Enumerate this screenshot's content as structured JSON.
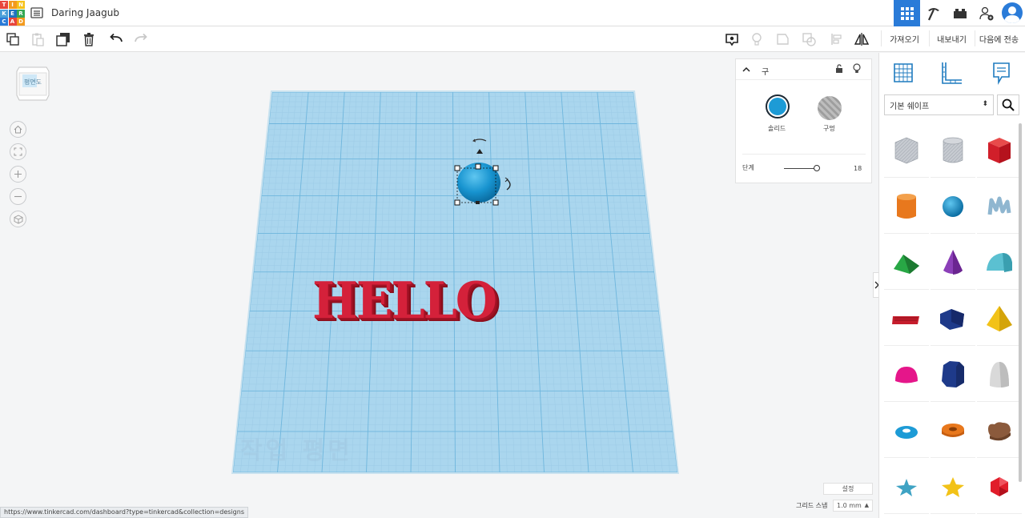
{
  "app": {
    "logo_letters": [
      "T",
      "I",
      "N",
      "K",
      "E",
      "R",
      "C",
      "A",
      "D"
    ],
    "logo_colors": [
      "#e8453c",
      "#f39a1e",
      "#f6c21a",
      "#4a9fd8",
      "#1f72bf",
      "#36a853",
      "#2a7bd8",
      "#e8453c",
      "#f39a1e"
    ],
    "design_title": "Daring Jaagub"
  },
  "topbar": {
    "buttons": [
      {
        "name": "3d-design-view",
        "icon": "grid-icon"
      },
      {
        "name": "codeblocks-view",
        "icon": "pickaxe-icon"
      },
      {
        "name": "bricks-view",
        "icon": "brick-icon"
      },
      {
        "name": "invite-user",
        "icon": "add-user-icon"
      }
    ]
  },
  "toolbar": {
    "import_label": "가져오기",
    "export_label": "내보내기",
    "send_label": "다음에 전송"
  },
  "viewcube": {
    "face_label": "평면도"
  },
  "workspace": {
    "text_object": "HELLO",
    "plane_label": "작업 평면",
    "settings_label": "설정",
    "snap_label": "그리드 스냅",
    "snap_value": "1.0 mm"
  },
  "inspector": {
    "shape_name": "구",
    "solid_label": "솔리드",
    "hole_label": "구멍",
    "steps_label": "단계",
    "steps_value": "18",
    "solid_color": "#1d9bd6"
  },
  "sidebar": {
    "category": "기본 쉐이프"
  },
  "status_bar": {
    "url": "https://www.tinkercad.com/dashboard?type=tinkercad&collection=designs"
  }
}
